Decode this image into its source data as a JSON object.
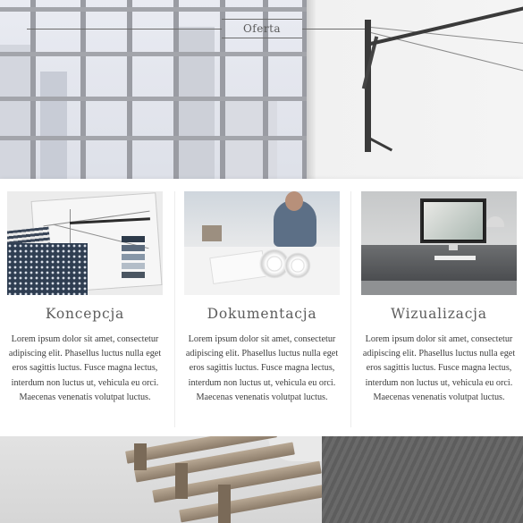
{
  "hero": {
    "title": "Oferta"
  },
  "offers": [
    {
      "title": "Koncepcja",
      "text": "Lorem ipsum dolor sit amet, consectetur adipiscing elit. Phasellus luctus nulla eget eros sagittis luctus. Fusce magna lectus, interdum non luctus ut, vehicula eu orci. Maecenas venenatis volutpat luctus."
    },
    {
      "title": "Dokumentacja",
      "text": "Lorem ipsum dolor sit amet, consectetur adipiscing elit. Phasellus luctus nulla eget eros sagittis luctus. Fusce magna lectus, interdum non luctus ut, vehicula eu orci. Maecenas venenatis volutpat luctus."
    },
    {
      "title": "Wizualizacja",
      "text": "Lorem ipsum dolor sit amet, consectetur adipiscing elit. Phasellus luctus nulla eget eros sagittis luctus. Fusce magna lectus, interdum non luctus ut, vehicula eu orci. Maecenas venenatis volutpat luctus."
    }
  ],
  "colors": {
    "heading": "#5c5c5c",
    "body_text": "#3c3c3c",
    "panel": "#ffffff"
  }
}
